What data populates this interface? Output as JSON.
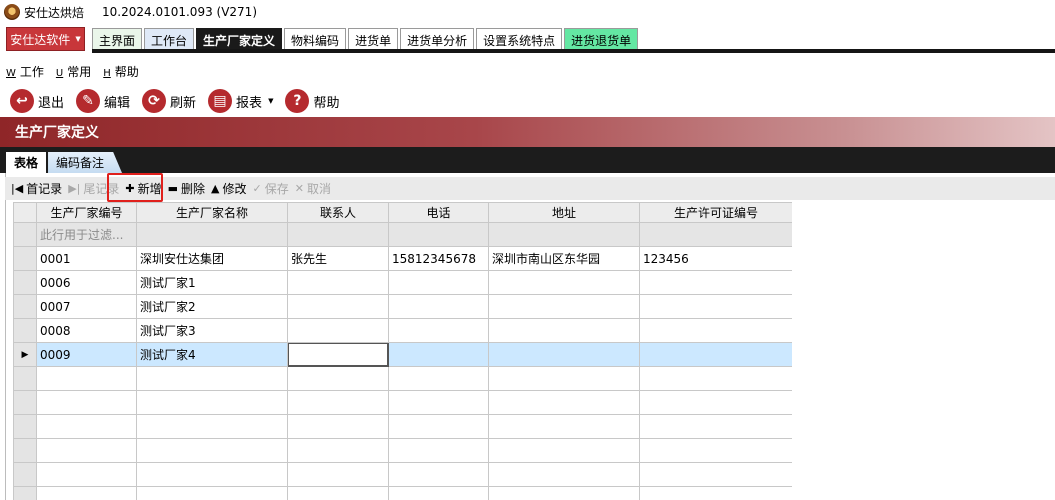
{
  "window": {
    "app_name": "安仕达烘焙",
    "version": "10.2024.0101.093 (V271)"
  },
  "brand_menu": {
    "label": "安仕达软件"
  },
  "tabs": [
    {
      "label": "主界面"
    },
    {
      "label": "工作台"
    },
    {
      "label": "生产厂家定义"
    },
    {
      "label": "物料编码"
    },
    {
      "label": "进货单"
    },
    {
      "label": "进货单分析"
    },
    {
      "label": "设置系统特点"
    },
    {
      "label": "进货退货单"
    }
  ],
  "menu": [
    {
      "key": "W",
      "label": "工作"
    },
    {
      "key": "U",
      "label": "常用"
    },
    {
      "key": "H",
      "label": "帮助"
    }
  ],
  "toolbar": {
    "exit": "退出",
    "edit": "编辑",
    "refresh": "刷新",
    "report": "报表",
    "help": "帮助"
  },
  "section": {
    "title": "生产厂家定义"
  },
  "sub_tabs": [
    {
      "label": "表格"
    },
    {
      "label": "编码备注"
    }
  ],
  "navigator": {
    "first": "首记录",
    "last": "尾记录",
    "add": "新增",
    "delete": "删除",
    "modify": "修改",
    "save": "保存",
    "cancel": "取消"
  },
  "grid": {
    "columns": [
      "生产厂家编号",
      "生产厂家名称",
      "联系人",
      "电话",
      "地址",
      "生产许可证编号"
    ],
    "filter_placeholder": "此行用于过滤...",
    "rows": [
      [
        "0001",
        "深圳安仕达集团",
        "张先生",
        "15812345678",
        "深圳市南山区东华园",
        "123456"
      ],
      [
        "0006",
        "测试厂家1",
        "",
        "",
        "",
        ""
      ],
      [
        "0007",
        "测试厂家2",
        "",
        "",
        "",
        ""
      ],
      [
        "0008",
        "测试厂家3",
        "",
        "",
        "",
        ""
      ],
      [
        "0009",
        "测试厂家4",
        "",
        "",
        "",
        ""
      ]
    ],
    "selected_row_index": 4
  },
  "colors": {
    "accent_red": "#b52a2e",
    "active_tab_bg": "#1a1a1a",
    "highlight_box": "#e0201c",
    "selected_row": "#cce8ff",
    "mint_tab": "#64e7a3"
  }
}
